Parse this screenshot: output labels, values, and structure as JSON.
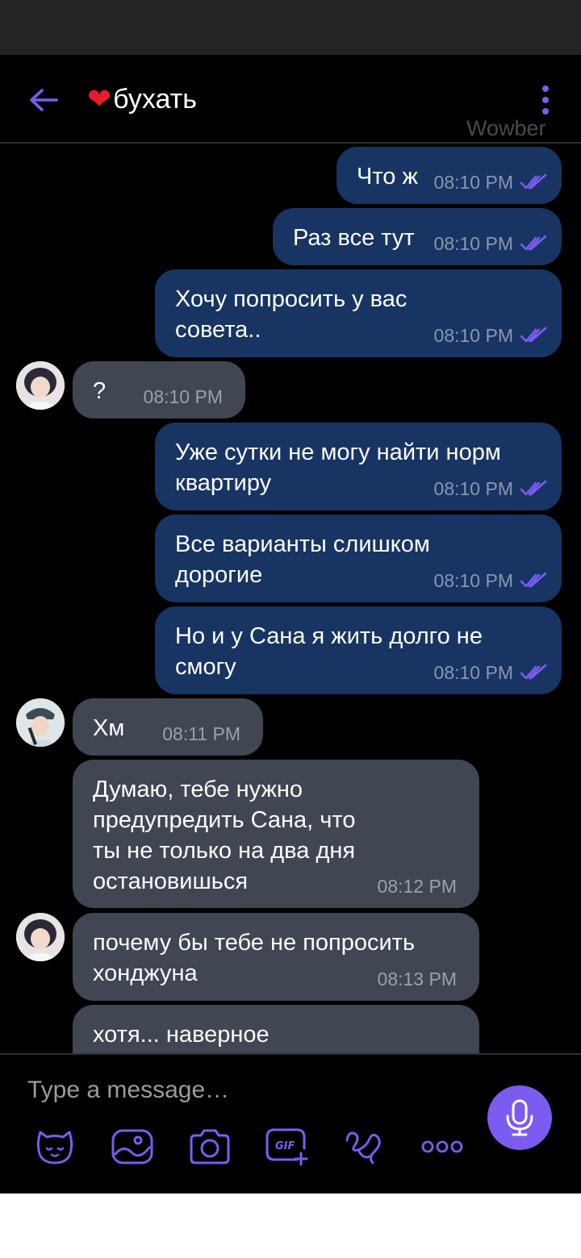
{
  "header": {
    "title": "бухать",
    "watermark": "Wowber"
  },
  "messages": [
    {
      "dir": "out",
      "text": "Что ж",
      "time": "08:10 PM",
      "status": "read"
    },
    {
      "dir": "out",
      "text": "Раз все тут",
      "time": "08:10 PM",
      "status": "read"
    },
    {
      "dir": "out",
      "text": "Хочу попросить у вас\nсовета..",
      "time": "08:10 PM",
      "status": "read"
    },
    {
      "dir": "in",
      "text": "?",
      "time": "08:10 PM"
    },
    {
      "dir": "out",
      "text": "Уже сутки не могу найти норм\nквартиру",
      "time": "08:10 PM",
      "status": "read"
    },
    {
      "dir": "out",
      "text": "Все варианты слишком\nдорогие",
      "time": "08:10 PM",
      "status": "read"
    },
    {
      "dir": "out",
      "text": "Но и у Сана я жить долго не\nсмогу",
      "time": "08:10 PM",
      "status": "read"
    },
    {
      "dir": "in",
      "text": "Хм",
      "time": "08:11 PM"
    },
    {
      "dir": "in",
      "text": "Думаю, тебе нужно\nпредупредить Сана, что\nты не только на два дня\nостановишься",
      "time": "08:12 PM"
    },
    {
      "dir": "in",
      "text": "почему бы тебе не попросить\nхонджуна",
      "time": "08:13 PM"
    },
    {
      "dir": "in",
      "text": "хотя... наверное",
      "time": ""
    }
  ],
  "composer": {
    "placeholder": "Type a message…",
    "tools": [
      "sticker-icon",
      "gallery-icon",
      "camera-icon",
      "gif-icon",
      "doodle-icon",
      "more-options-icon"
    ],
    "gif_label": "GIF"
  },
  "colors": {
    "accent": "#7c5cf0",
    "outgoing_bubble": "#173463",
    "incoming_bubble": "#404652",
    "heart": "#e81c2c"
  }
}
